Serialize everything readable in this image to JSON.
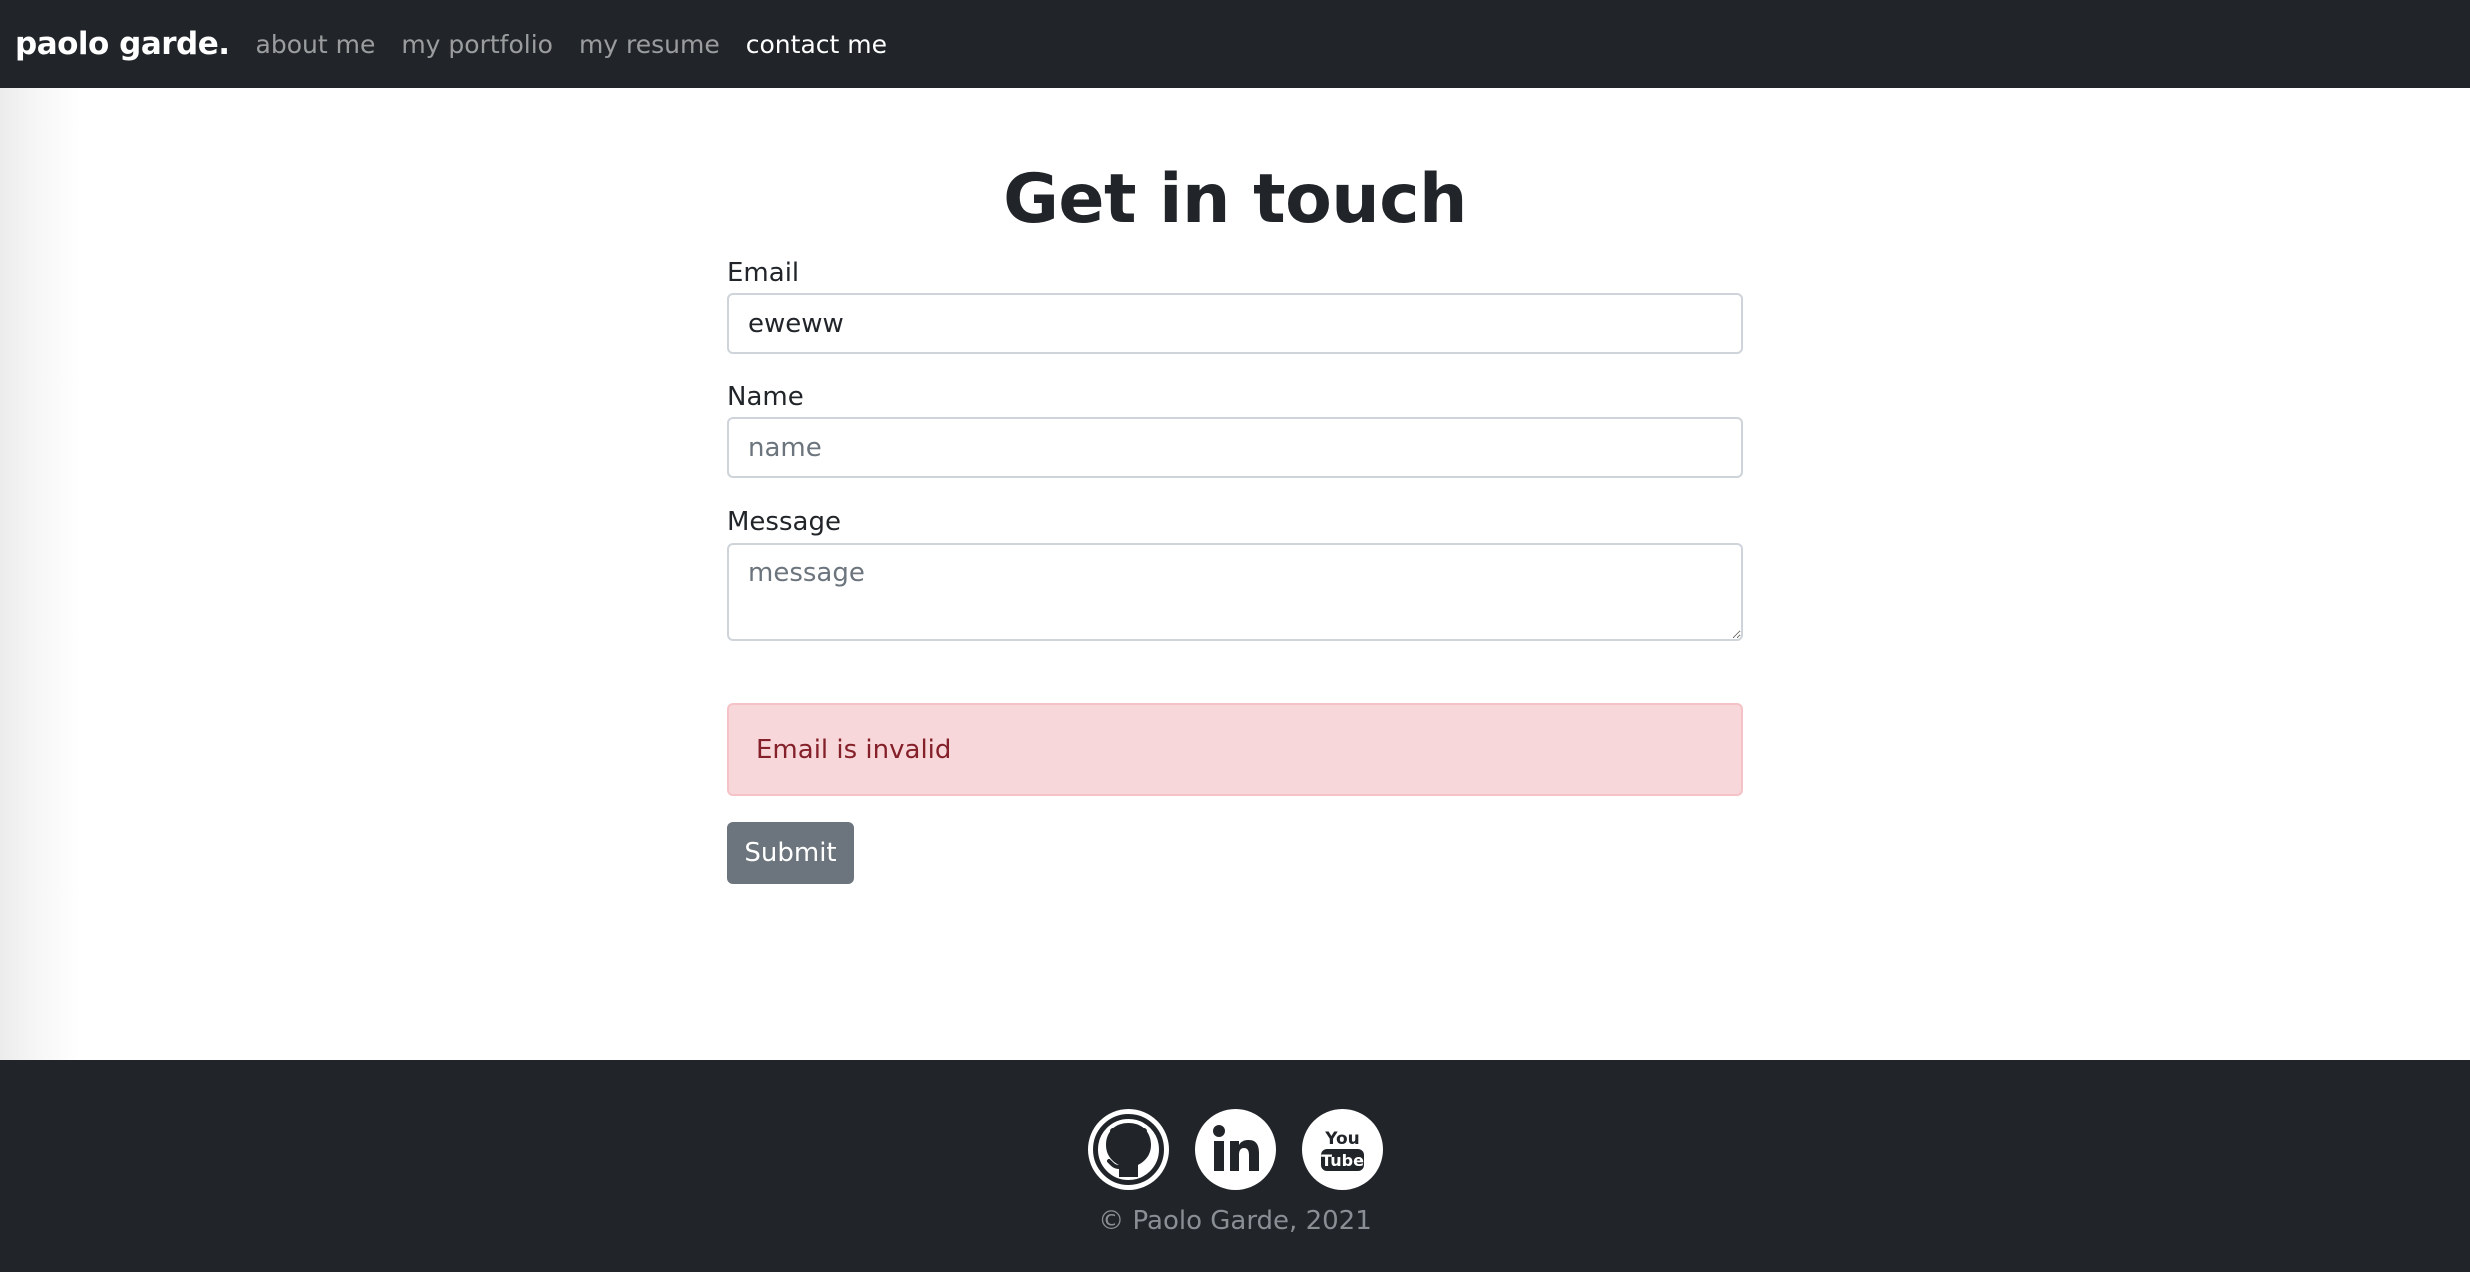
{
  "navbar": {
    "brand": "paolo garde.",
    "links": [
      {
        "label": "about me"
      },
      {
        "label": "my portfolio"
      },
      {
        "label": "my resume"
      },
      {
        "label": "contact me"
      }
    ]
  },
  "page": {
    "title": "Get in touch"
  },
  "form": {
    "email": {
      "label": "Email",
      "value": "eweww"
    },
    "name": {
      "label": "Name",
      "placeholder": "name"
    },
    "message": {
      "label": "Message",
      "placeholder": "message"
    },
    "error": "Email is invalid",
    "submit_label": "Submit"
  },
  "footer": {
    "icons": [
      "github-icon",
      "linkedin-icon",
      "youtube-icon"
    ],
    "copyright": "© Paolo Garde, 2021"
  },
  "colors": {
    "navbar_bg": "#212529",
    "alert_bg": "#f8d7da",
    "alert_text": "#842029",
    "button_bg": "#6c757d"
  }
}
